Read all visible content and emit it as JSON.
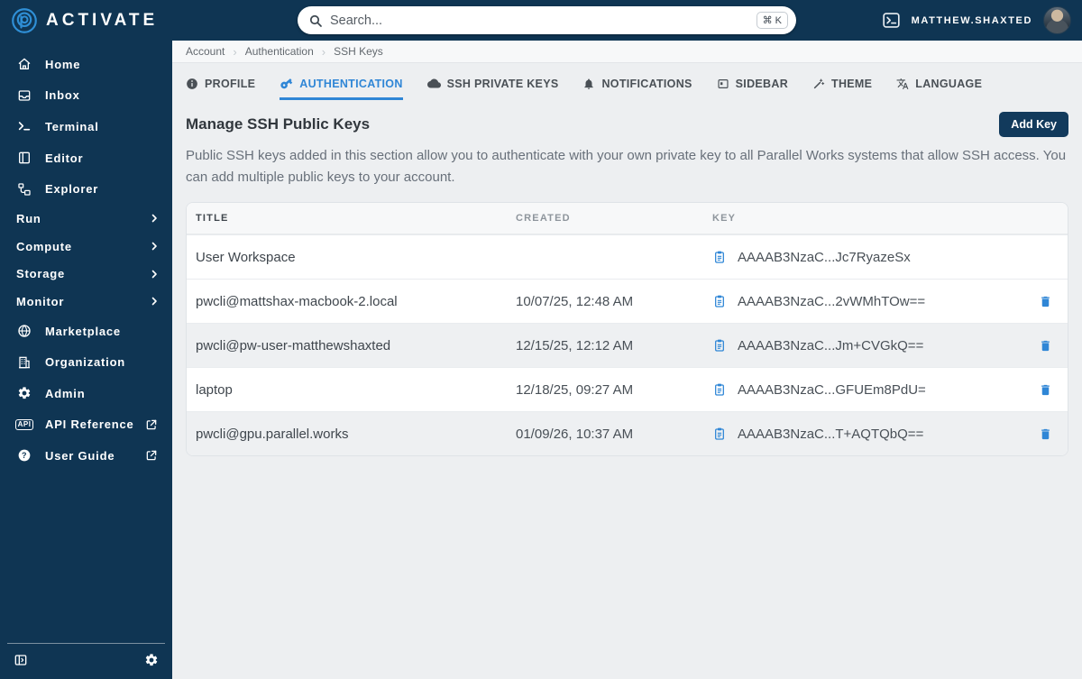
{
  "brand": {
    "name": "ACTIVATE"
  },
  "topbar": {
    "search": {
      "placeholder": "Search...",
      "shortcut": "⌘ K"
    },
    "user": {
      "name": "MATTHEW.SHAXTED"
    }
  },
  "sidebar": {
    "items": [
      {
        "label": "Home",
        "icon": "home-icon"
      },
      {
        "label": "Inbox",
        "icon": "inbox-icon"
      },
      {
        "label": "Terminal",
        "icon": "terminal-icon"
      },
      {
        "label": "Editor",
        "icon": "editor-icon"
      },
      {
        "label": "Explorer",
        "icon": "explorer-icon"
      }
    ],
    "groups": [
      {
        "label": "Run"
      },
      {
        "label": "Compute"
      },
      {
        "label": "Storage"
      },
      {
        "label": "Monitor"
      }
    ],
    "links": [
      {
        "label": "Marketplace",
        "icon": "globe-icon"
      },
      {
        "label": "Organization",
        "icon": "building-icon"
      },
      {
        "label": "Admin",
        "icon": "gear-icon"
      },
      {
        "label": "API Reference",
        "icon": "api-icon",
        "external": true
      },
      {
        "label": "User Guide",
        "icon": "question-icon",
        "external": true
      }
    ]
  },
  "breadcrumb": {
    "items": [
      "Account",
      "Authentication",
      "SSH Keys"
    ]
  },
  "tabs": [
    {
      "label": "PROFILE",
      "icon": "info-icon",
      "active": false
    },
    {
      "label": "AUTHENTICATION",
      "icon": "key-icon",
      "active": true
    },
    {
      "label": "SSH PRIVATE KEYS",
      "icon": "cloud-icon",
      "active": false
    },
    {
      "label": "NOTIFICATIONS",
      "icon": "bell-icon",
      "active": false
    },
    {
      "label": "SIDEBAR",
      "icon": "sidebar-panel-icon",
      "active": false
    },
    {
      "label": "THEME",
      "icon": "wand-icon",
      "active": false
    },
    {
      "label": "LANGUAGE",
      "icon": "translate-icon",
      "active": false
    }
  ],
  "section": {
    "title": "Manage SSH Public Keys",
    "add_button": "Add Key",
    "description": "Public SSH keys added in this section allow you to authenticate with your own private key to all Parallel Works systems that allow SSH access. You can add multiple public keys to your account."
  },
  "table": {
    "headers": {
      "title": "TITLE",
      "created": "CREATED",
      "key": "KEY"
    },
    "rows": [
      {
        "title": "User Workspace",
        "created": "",
        "key": "AAAAB3NzaC...Jc7RyazeSx",
        "deletable": false
      },
      {
        "title": "pwcli@mattshax-macbook-2.local",
        "created": "10/07/25, 12:48 AM",
        "key": "AAAAB3NzaC...2vWMhTOw==",
        "deletable": true
      },
      {
        "title": "pwcli@pw-user-matthewshaxted",
        "created": "12/15/25, 12:12 AM",
        "key": "AAAAB3NzaC...Jm+CVGkQ==",
        "deletable": true
      },
      {
        "title": "laptop",
        "created": "12/18/25, 09:27 AM",
        "key": "AAAAB3NzaC...GFUEm8PdU=",
        "deletable": true
      },
      {
        "title": "pwcli@gpu.parallel.works",
        "created": "01/09/26, 10:37 AM",
        "key": "AAAAB3NzaC...T+AQTQbQ==",
        "deletable": true
      }
    ]
  },
  "colors": {
    "navy": "#0f3553",
    "accent_blue": "#2f86d6",
    "logo_blue": "#2f8fd6"
  }
}
